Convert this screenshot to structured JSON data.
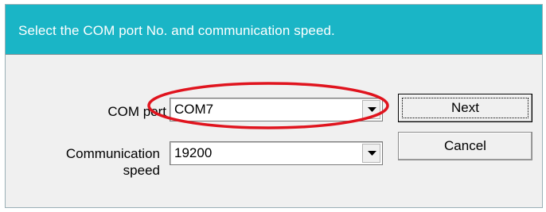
{
  "header": {
    "instruction": "Select the COM port No. and communication speed."
  },
  "form": {
    "com_port_label": "COM port",
    "com_port_value": "COM7",
    "speed_label_line1": "Communication",
    "speed_label_line2": "speed",
    "speed_value": "19200"
  },
  "buttons": {
    "next_label": "Next",
    "cancel_label": "Cancel"
  },
  "colors": {
    "header_bg": "#1ab5c6",
    "dialog_bg": "#f0f0f0",
    "highlight": "#e0141e"
  },
  "icons": {
    "dropdown": "chevron-down-icon"
  }
}
